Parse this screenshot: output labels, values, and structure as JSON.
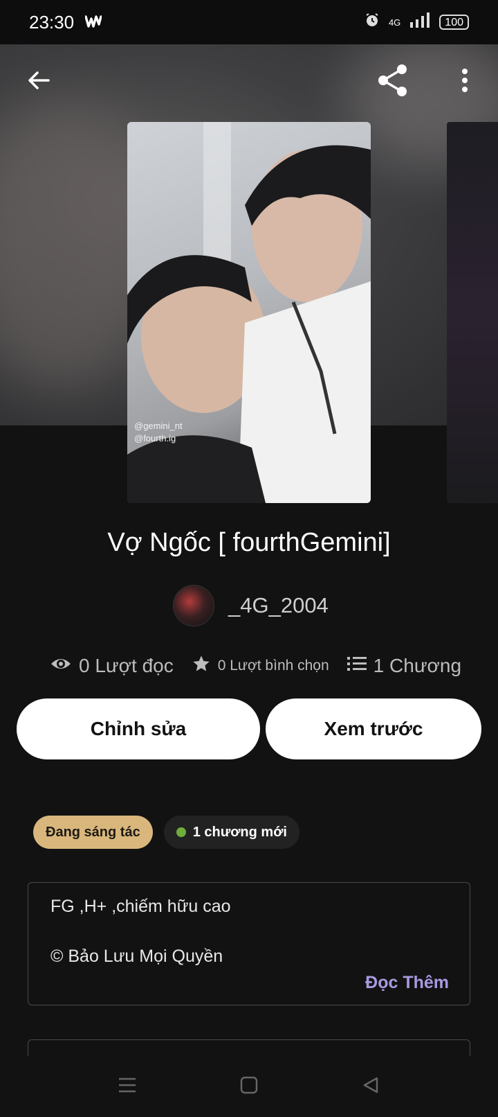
{
  "status_bar": {
    "time": "23:30",
    "network": "4G",
    "battery": "100"
  },
  "story": {
    "title": "Vợ Ngốc [ fourthGemini]",
    "cover_caption_line1": "@gemini_nt",
    "cover_caption_line2": "@fourth.ig",
    "author": "_4G_2004"
  },
  "stats": {
    "reads": "0 Lượt đọc",
    "votes": "0 Lượt bình chọn",
    "chapters": "1 Chương"
  },
  "actions": {
    "edit_label": "Chỉnh sửa",
    "preview_label": "Xem trước"
  },
  "badges": {
    "status": "Đang sáng tác",
    "new_chapter": "1 chương mới"
  },
  "description": {
    "line1": "FG ,H+ ,chiếm hữu cao",
    "line2": "© Bảo Lưu Mọi Quyền",
    "read_more": "Đọc Thêm"
  },
  "colors": {
    "background": "#121212",
    "status_badge": "#d9b77c",
    "new_dot": "#6fae3a",
    "read_more": "#a99ae0"
  },
  "icons": {
    "back": "back-arrow-icon",
    "share": "share-icon",
    "more": "more-vertical-icon",
    "reads": "eye-icon",
    "votes": "star-icon",
    "chapters": "list-icon",
    "status_app": "wattpad-logo-icon"
  }
}
